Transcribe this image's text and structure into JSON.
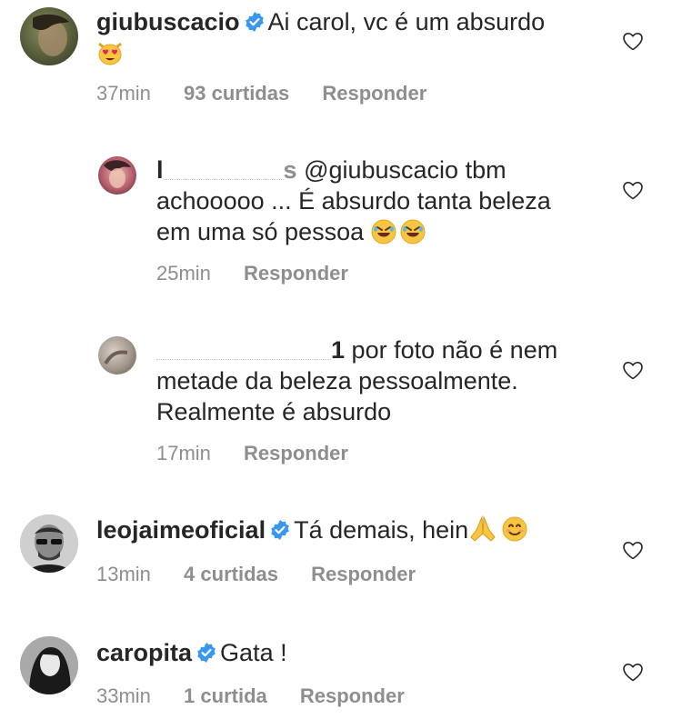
{
  "comments": [
    {
      "username": "giubuscacio",
      "verified": true,
      "text": "Ai carol, vc é um absurdo",
      "time": "37min",
      "likes": "93 curtidas",
      "reply": "Responder"
    },
    {
      "username_visible_start": "l",
      "username_visible_end": "s",
      "mention": "@giubuscacio",
      "text_line1_rest": "tbm",
      "text_line2": "achooooo ... É absurdo tanta beleza",
      "text_line3": "em uma só pessoa",
      "time": "25min",
      "reply": "Responder"
    },
    {
      "username_visible_end": "1",
      "text_line1_rest": "por foto não é nem",
      "text_line2": "metade da beleza pessoalmente.",
      "text_line3": "Realmente é absurdo",
      "time": "17min",
      "reply": "Responder"
    },
    {
      "username": "leojaimeoficial",
      "verified": true,
      "text": "Tá demais, hein",
      "time": "13min",
      "likes": "4 curtidas",
      "reply": "Responder"
    },
    {
      "username": "caropita",
      "verified": true,
      "text": "Gata !",
      "time": "33min",
      "likes": "1 curtida",
      "reply": "Responder"
    }
  ],
  "icons": {
    "verified": "verified-badge-icon",
    "heart": "heart-outline-icon",
    "emoji_heart_eyes_cat": "heart-eyes-cat-emoji",
    "emoji_rofl": "rolling-on-floor-laughing-emoji",
    "emoji_pray": "folded-hands-emoji",
    "emoji_smile": "smiling-face-emoji"
  },
  "colors": {
    "text": "#262626",
    "meta": "#8e8e8e",
    "verified": "#3897f0"
  }
}
